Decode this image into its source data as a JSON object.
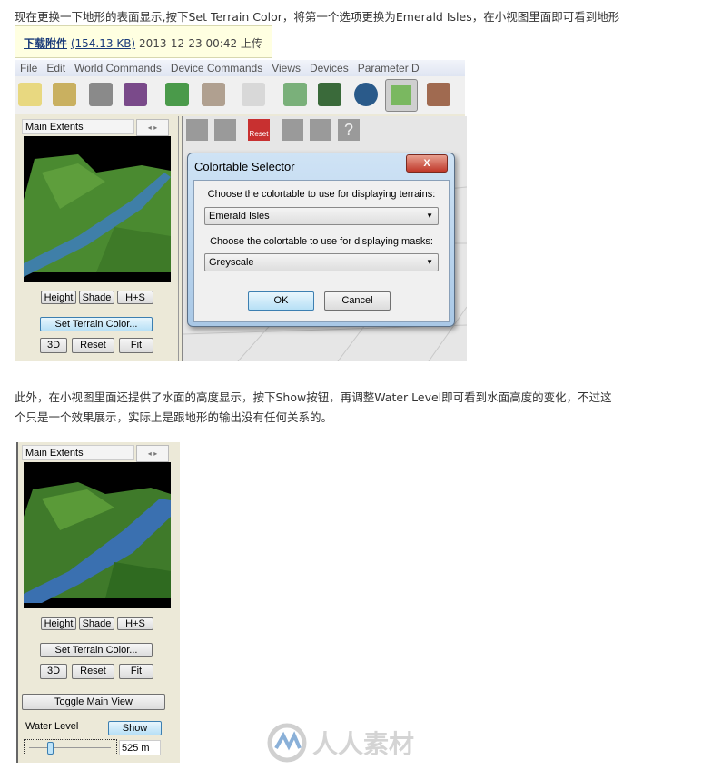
{
  "paragraphs": [
    "现在更换一下地形的表面显示,按下Set Terrain Color，将第一个选项更换为Emerald Isles，在小视图里面即可看到地形",
    "此外，在小视图里面还提供了水面的高度显示，按下Show按钮，再调整Water Level即可看到水面高度的变化，不过这",
    "个只是一个效果展示，实际上是跟地形的输出没有任何关系的。"
  ],
  "attachment": {
    "link": "下载附件",
    "size": "(154.13 KB)",
    "date": "2013-12-23 00:42",
    "suffix": "上传"
  },
  "menu": [
    "File",
    "Edit",
    "World Commands",
    "Device Commands",
    "Views",
    "Devices",
    "Parameter D"
  ],
  "toolbar_icons": [
    "new-project-icon",
    "open-folder-icon",
    "save-disk-icon",
    "build-icon",
    "terrain-graph-icon",
    "checklist-icon",
    "dice-icon",
    "network-icon",
    "map-grid-icon",
    "globe-icon",
    "terrain-view-icon",
    "texture-icon"
  ],
  "panel": {
    "title": "Main Extents",
    "buttons_row1": [
      "Height",
      "Shade",
      "H+S"
    ],
    "set_terrain": "Set Terrain Color...",
    "buttons_row2": [
      "3D",
      "Reset",
      "Fit"
    ],
    "toggle": "Toggle Main View",
    "water_label": "Water Level",
    "show": "Show",
    "water_value": "525 m",
    "water_slider_fraction": 0.22
  },
  "view_toolbar": {
    "reset_label": "Reset",
    "help": "?"
  },
  "dialog": {
    "title": "Colortable Selector",
    "close": "X",
    "terrain_label": "Choose the colortable to use for displaying terrains:",
    "terrain_value": "Emerald Isles",
    "mask_label": "Choose the colortable to use for displaying masks:",
    "mask_value": "Greyscale",
    "ok": "OK",
    "cancel": "Cancel"
  },
  "colors": {
    "accent_blue": "#3c7fb1",
    "tooltip_bg": "#ffffe1",
    "terrain_green": "#4f8a2e",
    "water": "#3f7fa8"
  }
}
